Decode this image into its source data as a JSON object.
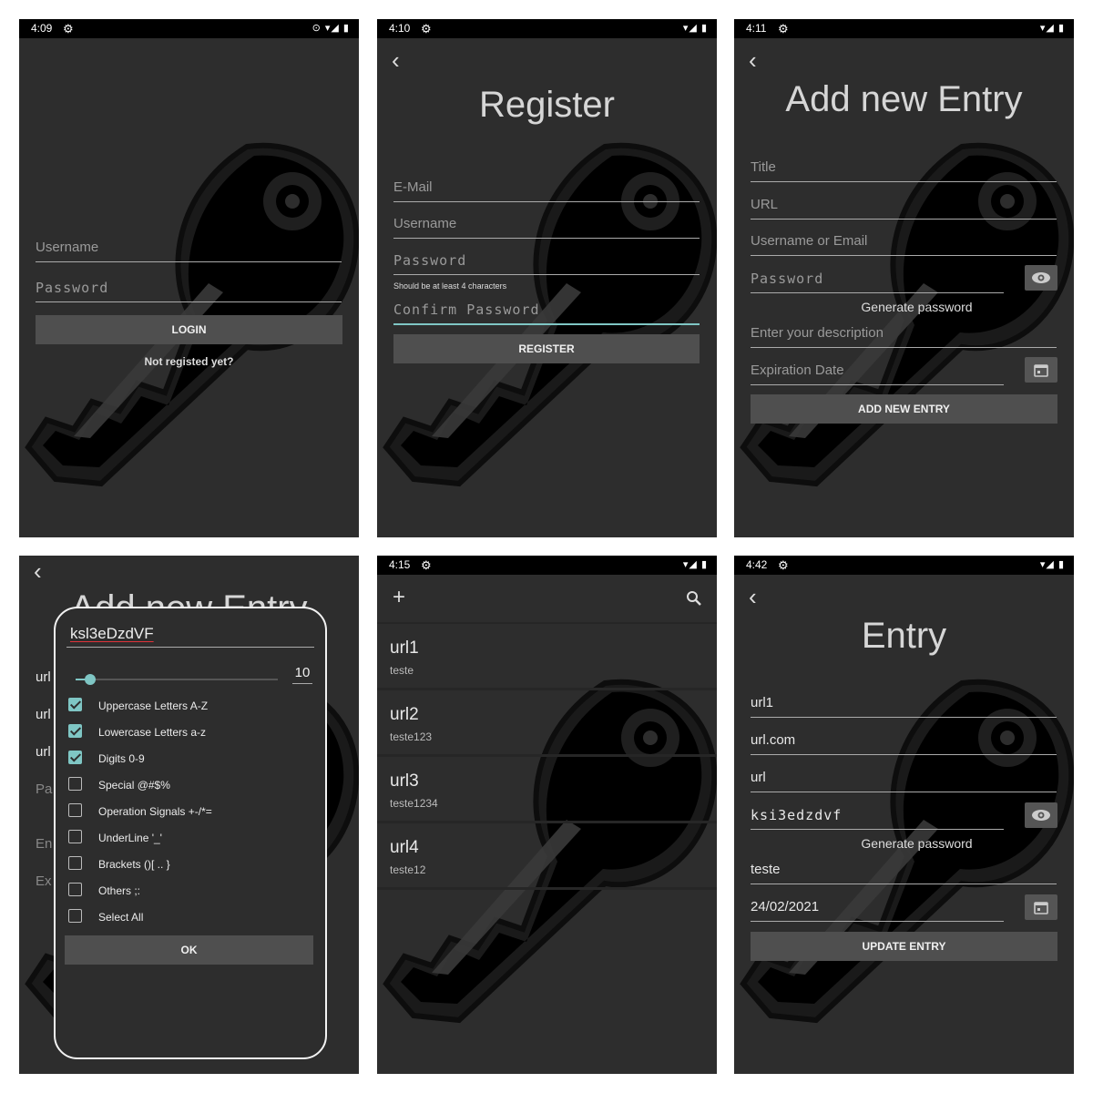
{
  "screens": {
    "login": {
      "status": {
        "time": "4:09",
        "right": "⊙ ▾◢ ▮"
      },
      "username_placeholder": "Username",
      "password_placeholder": "Password",
      "login_label": "LOGIN",
      "register_link": "Not registed yet?"
    },
    "register": {
      "status": {
        "time": "4:10",
        "right": "▾◢ ▮"
      },
      "title": "Register",
      "email_placeholder": "E-Mail",
      "username_placeholder": "Username",
      "password_placeholder": "Password",
      "password_hint": "Should be at least 4 characters",
      "confirm_placeholder": "Confirm Password",
      "register_label": "REGISTER"
    },
    "add_entry": {
      "status": {
        "time": "4:11",
        "right": "▾◢ ▮"
      },
      "title": "Add new Entry",
      "title_placeholder": "Title",
      "url_placeholder": "URL",
      "user_placeholder": "Username or Email",
      "password_placeholder": "Password",
      "generate_label": "Generate password",
      "description_placeholder": "Enter your description",
      "expiration_placeholder": "Expiration Date",
      "add_label": "ADD NEW ENTRY"
    },
    "generator": {
      "behind_title": "Add new Entry",
      "behind_fields": [
        "url",
        "url",
        "url",
        "Pa",
        "En",
        "Ex"
      ],
      "generated_password": "ksl3eDzdVF",
      "length": "10",
      "length_fraction": 0.07,
      "options": [
        {
          "label": "Uppercase Letters A-Z",
          "checked": true
        },
        {
          "label": "Lowercase Letters a-z",
          "checked": true
        },
        {
          "label": "Digits 0-9",
          "checked": true
        },
        {
          "label": "Special @#$%",
          "checked": false
        },
        {
          "label": "Operation Signals +-/*=",
          "checked": false
        },
        {
          "label": "UnderLine '_'",
          "checked": false
        },
        {
          "label": "Brackets ()[ .. }",
          "checked": false
        },
        {
          "label": "Others ;:",
          "checked": false
        },
        {
          "label": "Select All",
          "checked": false
        }
      ],
      "ok_label": "OK"
    },
    "list": {
      "status": {
        "time": "4:15",
        "right": "▾◢ ▮"
      },
      "entries": [
        {
          "title": "url1",
          "subtitle": "teste"
        },
        {
          "title": "url2",
          "subtitle": "teste123"
        },
        {
          "title": "url3",
          "subtitle": "teste1234"
        },
        {
          "title": "url4",
          "subtitle": "teste12"
        }
      ]
    },
    "entry": {
      "status": {
        "time": "4:42",
        "right": "▾◢ ▮"
      },
      "title": "Entry",
      "entry_title": "url1",
      "url": "url.com",
      "username": "url",
      "password": "ksi3edzdvf",
      "generate_label": "Generate password",
      "description": "teste",
      "expiration": "24/02/2021",
      "update_label": "UPDATE ENTRY"
    }
  },
  "colors": {
    "background": "#2d2d2d",
    "accent": "#7fc6c4",
    "button": "#4f4f4f",
    "statusbar": "#000000"
  },
  "icons": [
    "gear-icon",
    "back-icon",
    "eye-icon",
    "calendar-icon",
    "add-icon",
    "search-icon",
    "key-icon"
  ]
}
